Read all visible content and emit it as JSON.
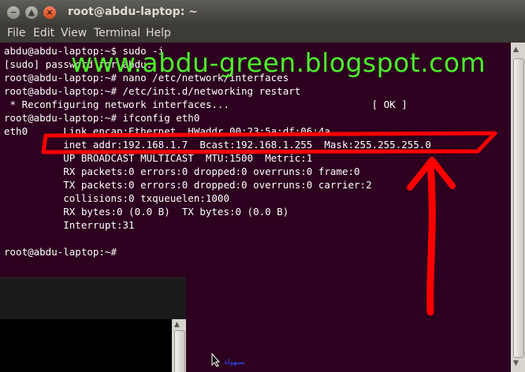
{
  "window": {
    "title": "root@abdu-laptop: ~",
    "buttons": {
      "close": "×",
      "minimize": "−",
      "maximize": "▲"
    }
  },
  "menu": [
    "File",
    "Edit",
    "View",
    "Terminal",
    "Help"
  ],
  "terminal": {
    "lines": [
      "abdu@abdu-laptop:~$ sudo -i",
      "[sudo] password for abdu:",
      "root@abdu-laptop:~# nano /etc/network/interfaces",
      "root@abdu-laptop:~# /etc/init.d/networking restart",
      " * Reconfiguring network interfaces...                        [ OK ]",
      "root@abdu-laptop:~# ifconfig eth0",
      "eth0      Link encap:Ethernet  HWaddr 00:23:5a:df:06:4a",
      "          inet addr:192.168.1.7  Bcast:192.168.1.255  Mask:255.255.255.0",
      "          UP BROADCAST MULTICAST  MTU:1500  Metric:1",
      "          RX packets:0 errors:0 dropped:0 overruns:0 frame:0",
      "          TX packets:0 errors:0 dropped:0 overruns:0 carrier:2",
      "          collisions:0 txqueuelen:1000",
      "          RX bytes:0 (0.0 B)  TX bytes:0 (0.0 B)",
      "          Interrupt:31",
      "",
      "root@abdu-laptop:~#"
    ]
  },
  "watermark": "www.abdu-green.blogspot.com",
  "bottom_link": "بسهولة",
  "colors": {
    "terminal_bg": "#2c001e",
    "watermark": "#4cef2b",
    "annotation": "#ff0000"
  }
}
